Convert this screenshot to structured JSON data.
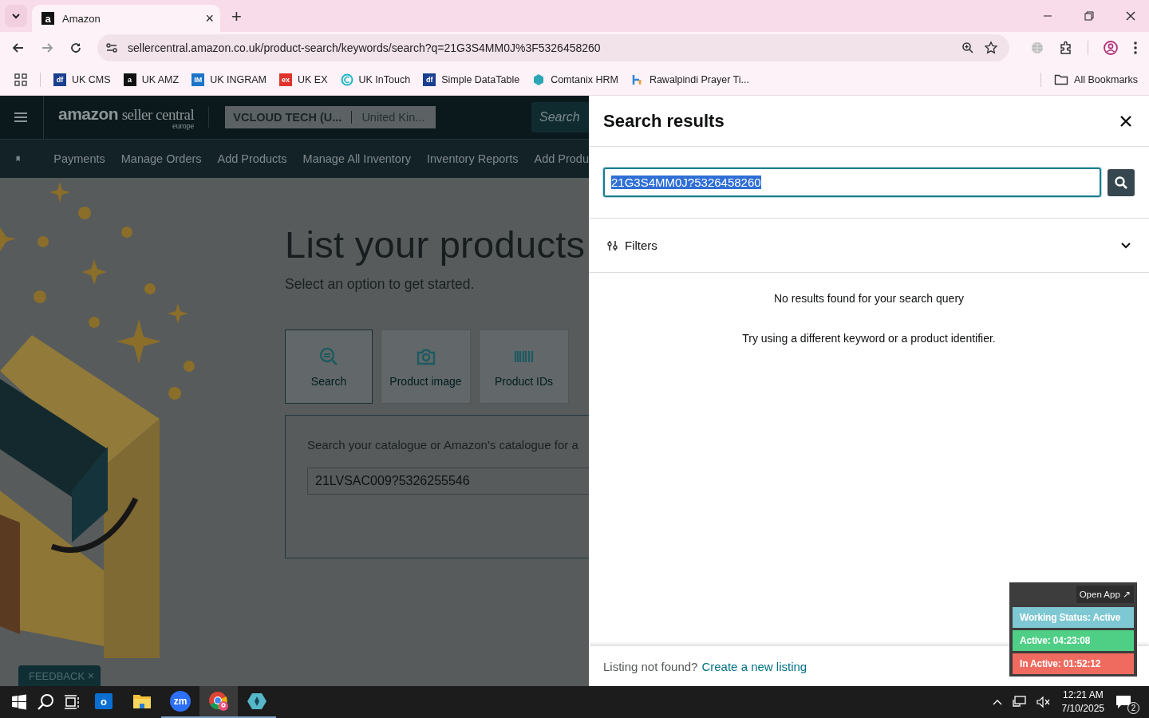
{
  "browser": {
    "tab": {
      "favicon": "a",
      "title": "Amazon",
      "close": "×"
    },
    "new_tab": "+",
    "url": "sellercentral.amazon.co.uk/product-search/keywords/search?q=21G3S4MM0J%3F5326458260",
    "bookmarks": [
      {
        "label": "UK CMS",
        "icon": {
          "kind": "badge",
          "text": "df",
          "color": "#1b3f8f"
        }
      },
      {
        "label": "UK AMZ",
        "icon": {
          "kind": "badge",
          "text": "a",
          "color": "#111111"
        }
      },
      {
        "label": "UK INGRAM",
        "icon": {
          "kind": "badge",
          "text": "IM",
          "color": "#1c74c9"
        }
      },
      {
        "label": "UK EX",
        "icon": {
          "kind": "badge",
          "text": "ex",
          "color": "#e0322c"
        }
      },
      {
        "label": "UK InTouch",
        "icon": {
          "kind": "ring",
          "color": "#1bb5c8"
        }
      },
      {
        "label": "Simple DataTable",
        "icon": {
          "kind": "badge",
          "text": "df",
          "color": "#1b3f8f"
        }
      },
      {
        "label": "Comtanix HRM",
        "icon": {
          "kind": "hex",
          "color": "#2aa7b5"
        }
      },
      {
        "label": "Rawalpindi Prayer Ti...",
        "icon": {
          "kind": "pin",
          "color": "#2f86d8"
        }
      }
    ],
    "all_bookmarks": "All Bookmarks"
  },
  "seller": {
    "logo": {
      "brand": "amazon",
      "product": "seller central",
      "region": "europe"
    },
    "account": {
      "name": "VCLOUD TECH (U...",
      "marketplace": "United Kin..."
    },
    "search": {
      "placeholder": "Search"
    },
    "nav": [
      "Payments",
      "Manage Orders",
      "Add Products",
      "Manage All Inventory",
      "Inventory Reports",
      "Add Produ"
    ],
    "title": "List your products",
    "subtitle": "Select an option to get started.",
    "options": [
      {
        "kind": "search",
        "label": "Search",
        "selected": true
      },
      {
        "kind": "camera",
        "label": "Product image",
        "selected": false
      },
      {
        "kind": "barcode",
        "label": "Product IDs",
        "selected": false
      }
    ],
    "search_card": {
      "prompt": "Search your catalogue or Amazon's catalogue for a",
      "value": "21LVSAC009?5326255546"
    },
    "feedback": {
      "label": "FEEDBACK",
      "close": "×"
    }
  },
  "drawer": {
    "title": "Search results",
    "query": {
      "value": "21G3S4MM0J?5326458260",
      "text_selected": true
    },
    "filters": {
      "label": "Filters",
      "expanded": false
    },
    "messages": [
      "No results found for your search query",
      "Try using a different keyword or a product identifier."
    ],
    "footer": {
      "text": "Listing not found?",
      "link": "Create a new listing"
    }
  },
  "widget": {
    "open_app": "Open App ↗",
    "statuses": [
      {
        "text": "Working Status: Active",
        "color": "#7ec8d3"
      },
      {
        "text": "Active: 04:23:08",
        "color": "#4fcf86"
      },
      {
        "text": "In Active: 01:52:12",
        "color": "#ef6b5f"
      }
    ]
  },
  "taskbar": {
    "apps": [
      {
        "kind": "outlook",
        "text": "o",
        "active": false,
        "running": false
      },
      {
        "kind": "folder",
        "active": false,
        "running": false
      },
      {
        "kind": "zoom",
        "text": "zm",
        "active": false,
        "running": true
      },
      {
        "kind": "chrome",
        "active": true,
        "running": true
      },
      {
        "kind": "gem",
        "active": false,
        "running": true
      }
    ],
    "time": "12:21 AM",
    "date": "7/10/2025",
    "notifications": "2"
  }
}
